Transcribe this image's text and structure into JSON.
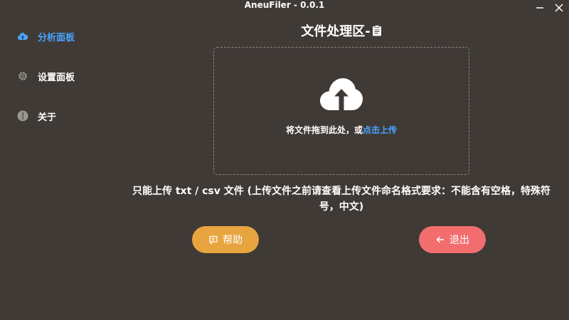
{
  "window": {
    "title": "AneuFiler - 0.0.1",
    "minimize_icon": "minimize-icon",
    "close_icon": "close-icon"
  },
  "sidebar": {
    "items": [
      {
        "label": "分析面板",
        "icon": "cloud-upload-icon",
        "active": true
      },
      {
        "label": "设置面板",
        "icon": "gear-icon",
        "active": false
      },
      {
        "label": "关于",
        "icon": "info-icon",
        "active": false
      }
    ]
  },
  "main": {
    "title": "文件处理区-",
    "title_icon": "clipboard-icon",
    "dropzone": {
      "icon": "cloud-upload-icon",
      "text_prefix": "将文件拖到此处，或",
      "link_text": "点击上传"
    },
    "notice": "只能上传 txt / csv 文件 (上传文件之前请查看上传文件命名格式要求：不能含有空格，特殊符号，中文)",
    "buttons": {
      "help_label": "帮助",
      "help_icon": "message-icon",
      "exit_label": "退出",
      "exit_icon": "arrow-left-icon"
    }
  },
  "colors": {
    "background": "#3f3a36",
    "accent": "#4aa3ff",
    "help_button": "#e8a53f",
    "exit_button": "#f26d6d"
  }
}
